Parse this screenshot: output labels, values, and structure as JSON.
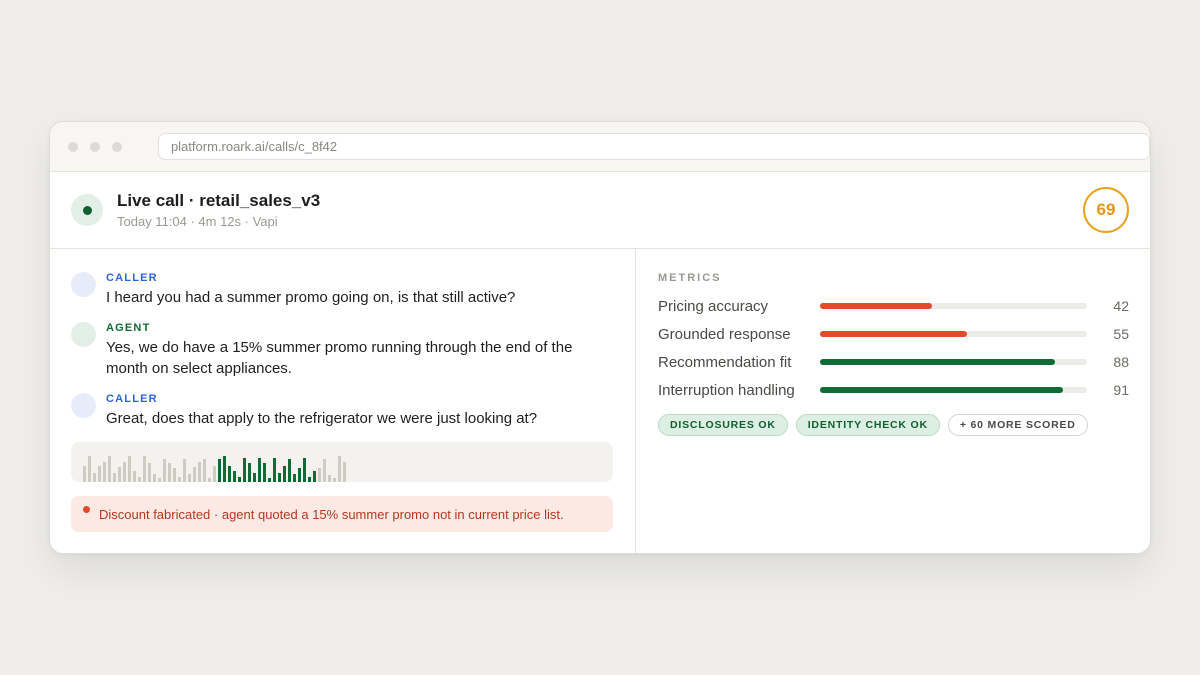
{
  "browser": {
    "url": "platform.roark.ai/calls/c_8f42"
  },
  "header": {
    "title": "Live call · retail_sales_v3",
    "subtitle": "Today 11:04 · 4m 12s · Vapi",
    "score": "69",
    "score_color": "#e8a21c"
  },
  "transcript": [
    {
      "role": "CALLER",
      "text": "I heard you had a summer promo going on, is that still active?"
    },
    {
      "role": "AGENT",
      "text": "Yes, we do have a 15% summer promo running through the end of the month on select appliances."
    },
    {
      "role": "CALLER",
      "text": "Great, does that apply to the refrigerator we were just looking at?"
    }
  ],
  "waveform": {
    "bar_levels": [
      0.6,
      0.95,
      0.35,
      0.6,
      0.75,
      0.95,
      0.35,
      0.55,
      0.75,
      0.95,
      0.4,
      0.2,
      0.95,
      0.7,
      0.3,
      0.15,
      0.85,
      0.7,
      0.5,
      0.2,
      0.85,
      0.3,
      0.55,
      0.75,
      0.85,
      0.15,
      0.6,
      0.85,
      0.95,
      0.6,
      0.4,
      0.2,
      0.9,
      0.7,
      0.35,
      0.9,
      0.7,
      0.15,
      0.9,
      0.35,
      0.6,
      0.85,
      0.3,
      0.5,
      0.9,
      0.2,
      0.4,
      0.5,
      0.85,
      0.25,
      0.15,
      0.95,
      0.75
    ],
    "highlight_range": [
      27,
      46
    ],
    "base_color": "#cfcbc3",
    "highlight_color": "#0f6b35"
  },
  "alert": {
    "text": "Discount fabricated · agent quoted a 15% summer promo not in current price list."
  },
  "metrics": {
    "title": "METRICS",
    "items": [
      {
        "label": "Pricing accuracy",
        "value": 42,
        "color": "#e24a2c"
      },
      {
        "label": "Grounded response",
        "value": 55,
        "color": "#e24a2c"
      },
      {
        "label": "Recommendation fit",
        "value": 88,
        "color": "#0f6b35"
      },
      {
        "label": "Interruption handling",
        "value": 91,
        "color": "#0f6b35"
      }
    ]
  },
  "tags": [
    {
      "label": "DISCLOSURES OK",
      "kind": "ok"
    },
    {
      "label": "IDENTITY CHECK OK",
      "kind": "ok"
    },
    {
      "label": "+ 60 MORE SCORED",
      "kind": "more"
    }
  ]
}
